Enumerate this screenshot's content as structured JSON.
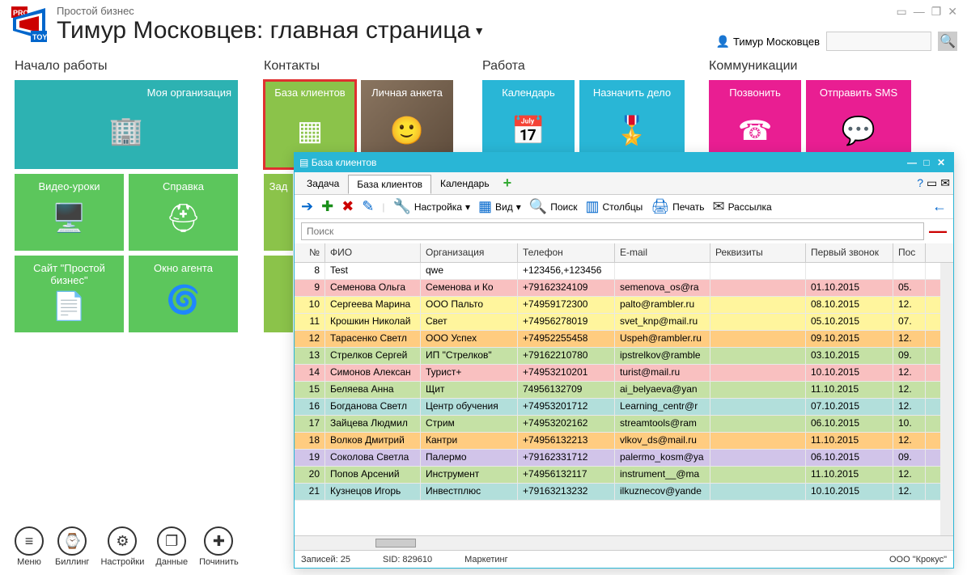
{
  "header": {
    "app_subtitle": "Простой бизнес",
    "page_title": "Тимур Московцев: главная страница",
    "user_name": "Тимур Московцев",
    "search_placeholder": ""
  },
  "sections": {
    "start": {
      "title": "Начало работы",
      "my_org": "Моя организация",
      "video": "Видео-уроки",
      "help": "Справка",
      "site": "Сайт \"Простой бизнес\"",
      "agent": "Окно агента"
    },
    "contacts": {
      "title": "Контакты",
      "clients": "База клиентов",
      "personal": "Личная анкета",
      "tasks_partial": "Зад"
    },
    "work": {
      "title": "Работа",
      "calendar": "Календарь",
      "assign": "Назначить дело"
    },
    "comm": {
      "title": "Коммуникации",
      "call": "Позвонить",
      "sms": "Отправить SMS"
    }
  },
  "bottom": {
    "menu": "Меню",
    "billing": "Биллинг",
    "settings": "Настройки",
    "data": "Данные",
    "repair": "Починить"
  },
  "dbwin": {
    "title": "База клиентов",
    "tabs": {
      "task": "Задача",
      "clients": "База клиентов",
      "calendar": "Календарь"
    },
    "toolbar": {
      "settings": "Настройка",
      "view": "Вид",
      "search": "Поиск",
      "columns": "Столбцы",
      "print": "Печать",
      "mailing": "Рассылка"
    },
    "search_placeholder": "Поиск",
    "cols": {
      "no": "№",
      "fio": "ФИО",
      "org": "Организация",
      "tel": "Телефон",
      "email": "E-mail",
      "req": "Реквизиты",
      "first": "Первый звонок",
      "last": "Пос"
    },
    "rows": [
      {
        "no": "8",
        "fio": "Test",
        "org": "qwe",
        "tel": "+123456,+123456",
        "email": "",
        "req": "",
        "first": "",
        "last": "",
        "cls": "row-white"
      },
      {
        "no": "9",
        "fio": "Семенова Ольга",
        "org": "Семенова и Ко",
        "tel": "+79162324109",
        "email": "semenova_os@ra",
        "req": "",
        "first": "01.10.2015",
        "last": "05.",
        "cls": "row-pink"
      },
      {
        "no": "10",
        "fio": "Сергеева Марина",
        "org": "ООО Пальто",
        "tel": "+74959172300",
        "email": "palto@rambler.ru",
        "req": "",
        "first": "08.10.2015",
        "last": "12.",
        "cls": "row-yellow"
      },
      {
        "no": "11",
        "fio": "Крошкин Николай",
        "org": "Свет",
        "tel": "+74956278019",
        "email": "svet_knp@mail.ru",
        "req": "",
        "first": "05.10.2015",
        "last": "07.",
        "cls": "row-yellow"
      },
      {
        "no": "12",
        "fio": "Тарасенко Светл",
        "org": "ООО Успех",
        "tel": "+74952255458",
        "email": "Uspeh@rambler.ru",
        "req": "",
        "first": "09.10.2015",
        "last": "12.",
        "cls": "row-orange"
      },
      {
        "no": "13",
        "fio": "Стрелков Сергей",
        "org": "ИП \"Стрелков\"",
        "tel": "+79162210780",
        "email": "ipstrelkov@ramble",
        "req": "",
        "first": "03.10.2015",
        "last": "09.",
        "cls": "row-green"
      },
      {
        "no": "14",
        "fio": "Симонов Алексан",
        "org": "Турист+",
        "tel": "+74953210201",
        "email": "turist@mail.ru",
        "req": "",
        "first": "10.10.2015",
        "last": "12.",
        "cls": "row-pink"
      },
      {
        "no": "15",
        "fio": "Беляева Анна",
        "org": "Щит",
        "tel": "74956132709",
        "email": "ai_belyaeva@yan",
        "req": "",
        "first": "11.10.2015",
        "last": "12.",
        "cls": "row-green"
      },
      {
        "no": "16",
        "fio": "Богданова Светл",
        "org": "Центр обучения",
        "tel": "+74953201712",
        "email": "Learning_centr@r",
        "req": "",
        "first": "07.10.2015",
        "last": "12.",
        "cls": "row-mint"
      },
      {
        "no": "17",
        "fio": "Зайцева Людмил",
        "org": "Стрим",
        "tel": "+74953202162",
        "email": "streamtools@ram",
        "req": "",
        "first": "06.10.2015",
        "last": "10.",
        "cls": "row-green"
      },
      {
        "no": "18",
        "fio": "Волков Дмитрий",
        "org": "Кантри",
        "tel": "+74956132213",
        "email": "vlkov_ds@mail.ru",
        "req": "",
        "first": "11.10.2015",
        "last": "12.",
        "cls": "row-orange"
      },
      {
        "no": "19",
        "fio": "Соколова Светла",
        "org": "Палермо",
        "tel": "+79162331712",
        "email": "palermo_kosm@ya",
        "req": "",
        "first": "06.10.2015",
        "last": "09.",
        "cls": "row-purple"
      },
      {
        "no": "20",
        "fio": "Попов Арсений",
        "org": "Инструмент",
        "tel": "+74956132117",
        "email": "instrument__@ma",
        "req": "",
        "first": "11.10.2015",
        "last": "12.",
        "cls": "row-green"
      },
      {
        "no": "21",
        "fio": "Кузнецов Игорь",
        "org": "Инвестплюс",
        "tel": "+79163213232",
        "email": "ilkuznecov@yande",
        "req": "",
        "first": "10.10.2015",
        "last": "12.",
        "cls": "row-mint"
      }
    ],
    "status": {
      "records": "Записей: 25",
      "sid": "SID: 829610",
      "category": "Маркетинг",
      "company": "ООО \"Крокус\""
    }
  }
}
